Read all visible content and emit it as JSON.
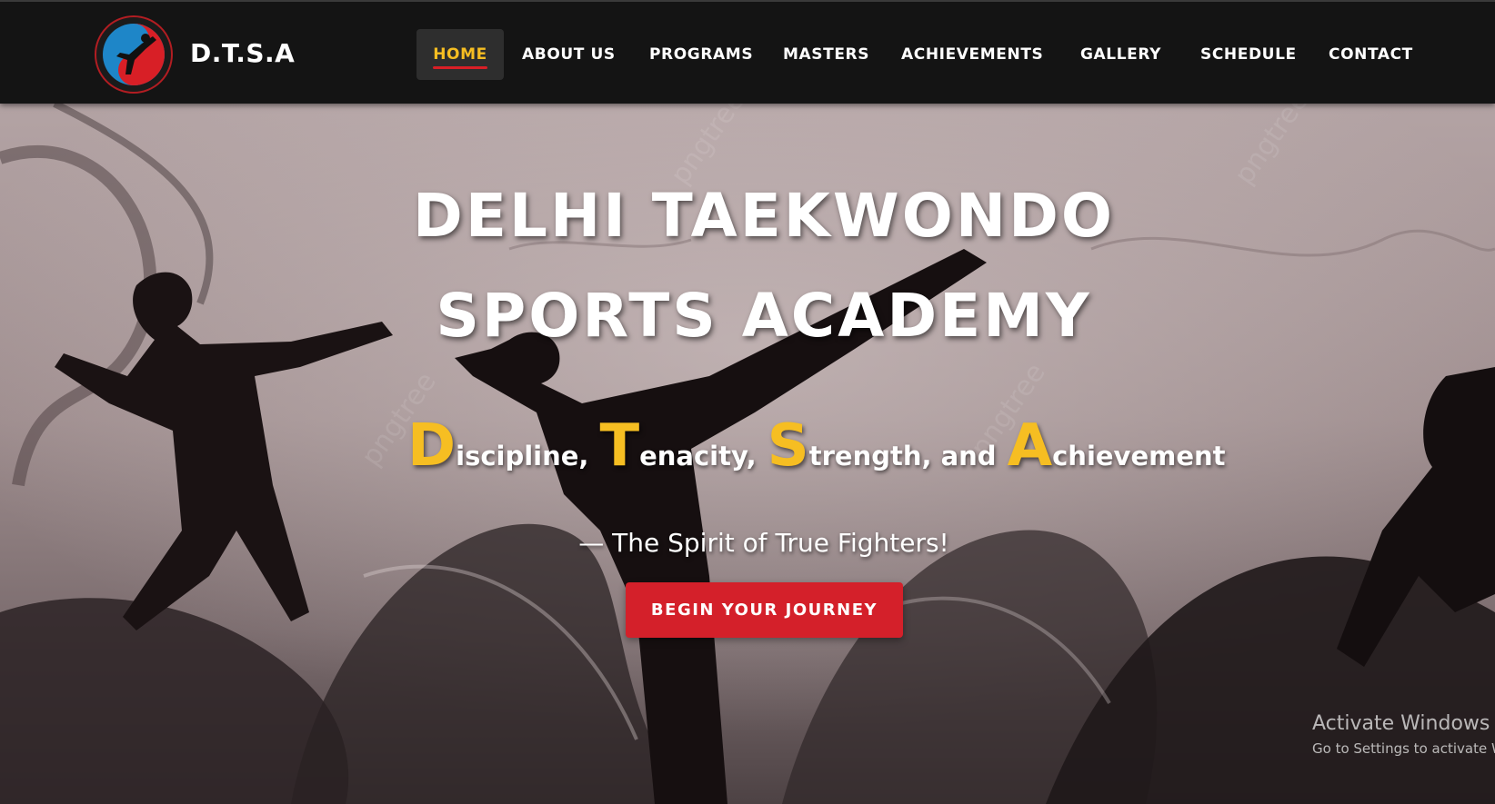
{
  "header": {
    "brand": "D.T.S.A",
    "logo_icon": "taekwondo-kick-logo-icon",
    "nav": [
      {
        "label": "HOME",
        "active": true
      },
      {
        "label": "ABOUT US"
      },
      {
        "label": "PROGRAMS"
      },
      {
        "label": "MASTERS"
      },
      {
        "label": "ACHIEVEMENTS"
      },
      {
        "label": "GALLERY"
      },
      {
        "label": "SCHEDULE"
      },
      {
        "label": "CONTACT"
      }
    ]
  },
  "hero": {
    "title_line1": "DELHI TAEKWONDO",
    "title_line2": "SPORTS ACADEMY",
    "motto": [
      {
        "cap": "D",
        "rest": "iscipline,"
      },
      {
        "cap": "T",
        "rest": "enacity,"
      },
      {
        "cap": "S",
        "rest": "trength, and"
      },
      {
        "cap": "A",
        "rest": "chievement"
      }
    ],
    "spirit": "— The Spirit of True Fighters!",
    "cta_label": "BEGIN YOUR JOURNEY",
    "watermark_text": "pngtree"
  },
  "os_watermark": {
    "line1": "Activate Windows",
    "line2": "Go to Settings to activate Windows."
  },
  "colors": {
    "accent_yellow": "#f6be22",
    "accent_red": "#d4202a",
    "nav_bg": "#141414"
  }
}
